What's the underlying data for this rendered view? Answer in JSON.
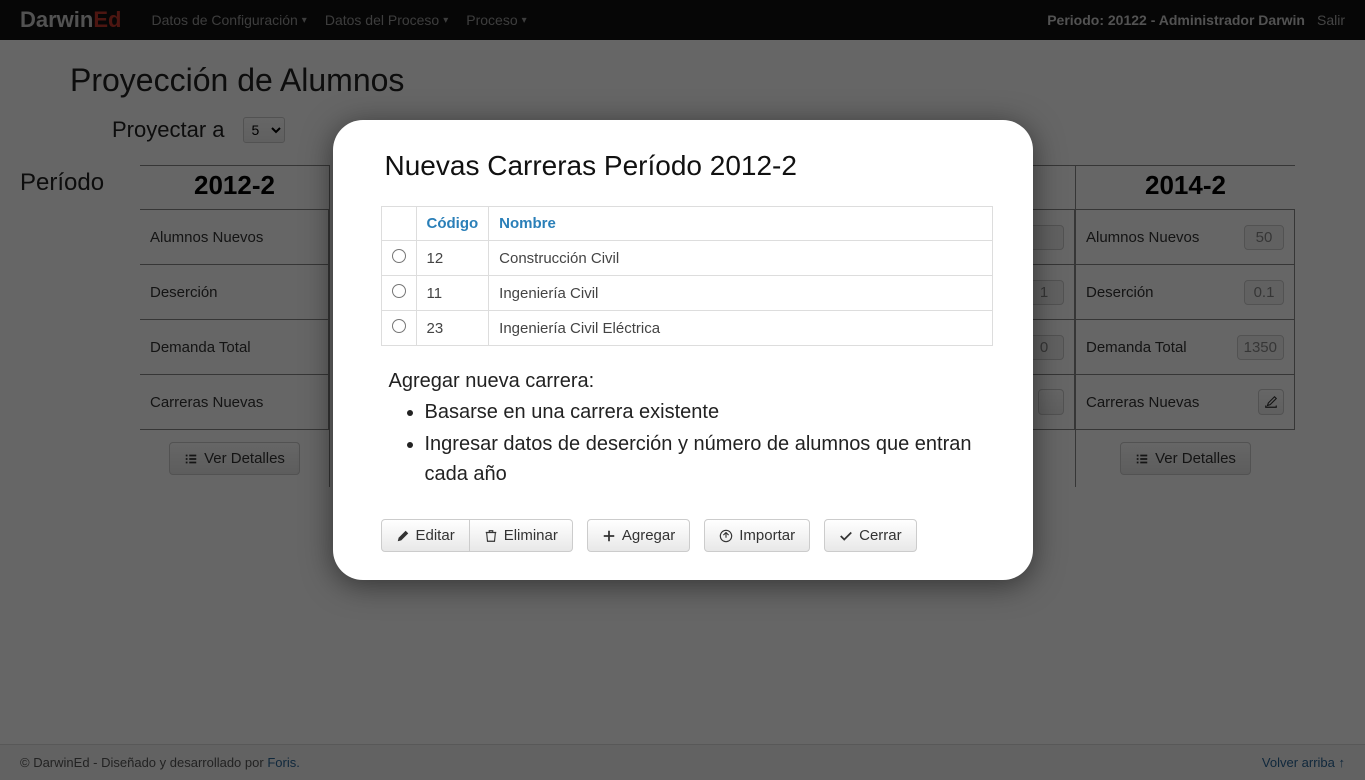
{
  "navbar": {
    "brand_prefix": "Darwin",
    "brand_suffix": "Ed",
    "menu": [
      "Datos de Configuración",
      "Datos del Proceso",
      "Proceso"
    ],
    "period_info": "Periodo: 20122 - Administrador Darwin",
    "logout": "Salir"
  },
  "page": {
    "title": "Proyección de Alumnos",
    "proyectar_label": "Proyectar a",
    "proyectar_value": "5",
    "period_header_label": "Período",
    "periods": [
      {
        "label": "2012-2"
      },
      {
        "label": "2014-2"
      }
    ],
    "row_labels": {
      "alumnos_nuevos": "Alumnos Nuevos",
      "desercion": "Deserción",
      "demanda_total": "Demanda Total",
      "carreras_nuevas": "Carreras Nuevas"
    },
    "values_right": {
      "alumnos_nuevos": "50",
      "desercion": "0.1",
      "demanda_total": "1350"
    },
    "partial_values": {
      "desercion_tail": "1",
      "demanda_tail": "0"
    },
    "ver_detalles": "Ver Detalles"
  },
  "modal": {
    "title": "Nuevas Carreras Período 2012-2",
    "headers": {
      "codigo": "Código",
      "nombre": "Nombre"
    },
    "rows": [
      {
        "codigo": "12",
        "nombre": "Construcción Civil"
      },
      {
        "codigo": "11",
        "nombre": "Ingeniería Civil"
      },
      {
        "codigo": "23",
        "nombre": "Ingeniería Civil Eléctrica"
      }
    ],
    "add_heading": "Agregar nueva carrera:",
    "add_bullets": [
      "Basarse en una carrera existente",
      "Ingresar datos de deserción y número de alumnos que entran cada año"
    ],
    "buttons": {
      "editar": "Editar",
      "eliminar": "Eliminar",
      "agregar": "Agregar",
      "importar": "Importar",
      "cerrar": "Cerrar"
    }
  },
  "footer": {
    "copyright_prefix": "© DarwinEd - Diseñado y desarrollado por ",
    "foris": "Foris.",
    "back_top": "Volver arriba ↑"
  }
}
